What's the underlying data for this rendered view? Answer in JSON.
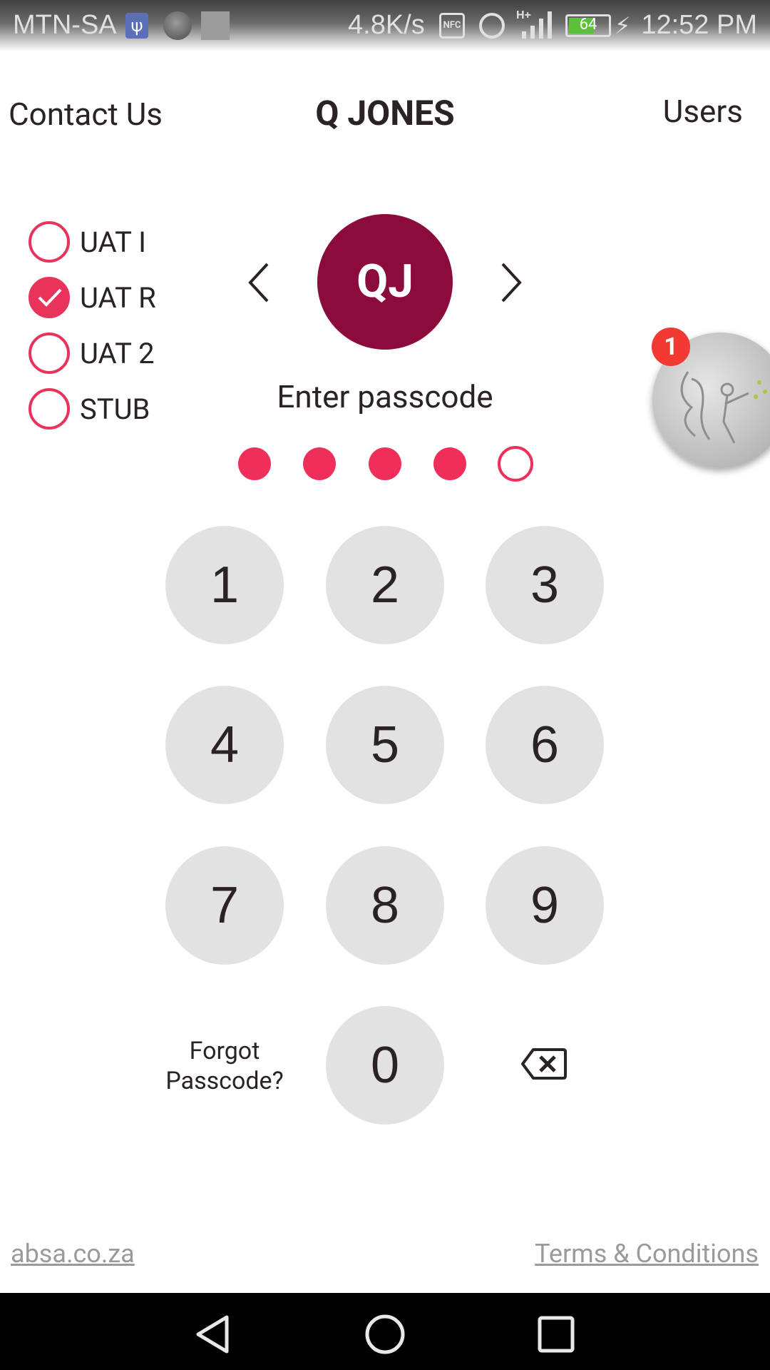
{
  "status_bar": {
    "carrier": "MTN-SA",
    "net_speed": "4.8K/s",
    "nfc_label": "NFC",
    "network_type": "H+",
    "battery_level": "64",
    "time": "12:52 PM"
  },
  "header": {
    "contact_label": "Contact Us",
    "user_name": "Q JONES",
    "users_label": "Users"
  },
  "environments": [
    {
      "label": "UAT I",
      "checked": false
    },
    {
      "label": "UAT R",
      "checked": true
    },
    {
      "label": "UAT 2",
      "checked": false
    },
    {
      "label": "STUB",
      "checked": false
    }
  ],
  "user": {
    "initials": "QJ",
    "prompt": "Enter passcode"
  },
  "passcode": {
    "length": 5,
    "entered": 4
  },
  "keypad": {
    "keys": [
      "1",
      "2",
      "3",
      "4",
      "5",
      "6",
      "7",
      "8",
      "9",
      "0"
    ],
    "forgot_line1": "Forgot",
    "forgot_line2": "Passcode?"
  },
  "notification_badge": "1",
  "footer": {
    "site_link": "absa.co.za",
    "terms_link": "Terms & Conditions"
  },
  "colors": {
    "accent": "#e8345a",
    "avatar_bg": "#8a0b3c",
    "key_bg": "#e2e2e2",
    "badge": "#f23a32"
  }
}
